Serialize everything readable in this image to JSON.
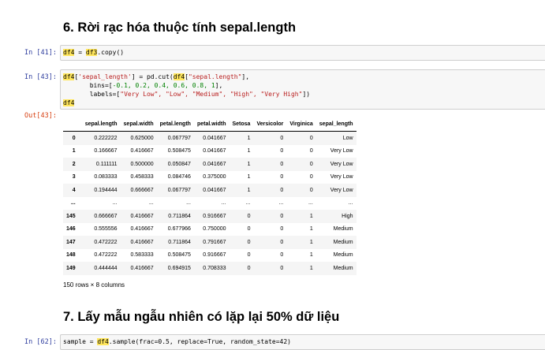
{
  "section6": {
    "heading": "6. Rời rạc hóa thuộc tính sepal.length"
  },
  "cell41": {
    "prompt": "In [41]:",
    "line1": {
      "var": "df4",
      "mid": " = ",
      "src": "df3",
      "end": ".copy()"
    }
  },
  "cell43": {
    "prompt": "In [43]:",
    "line1": {
      "var": "df4",
      "key": "'sepal_length'",
      "mid": "] = pd.cut(",
      "src": "df4",
      "col": "\"sepal.length\"",
      "end": "],",
      "open": "["
    },
    "line2": {
      "pre": "       bins=[",
      "nums": "-0.1, 0.2, 0.4, 0.6, 0.8, 1",
      "end": "],"
    },
    "line3": {
      "pre": "       labels=[",
      "labels": "\"Very Low\", \"Low\", \"Medium\", \"High\", \"Very High\"",
      "end": "])"
    },
    "line4": {
      "var": "df4"
    },
    "out_prompt": "Out[43]:"
  },
  "table": {
    "columns": [
      "",
      "sepal.length",
      "sepal.width",
      "petal.length",
      "petal.width",
      "Setosa",
      "Versicolor",
      "Virginica",
      "sepal_length"
    ],
    "rows": [
      [
        "0",
        "0.222222",
        "0.625000",
        "0.067797",
        "0.041667",
        "1",
        "0",
        "0",
        "Low"
      ],
      [
        "1",
        "0.166667",
        "0.416667",
        "0.508475",
        "0.041667",
        "1",
        "0",
        "0",
        "Very Low"
      ],
      [
        "2",
        "0.111111",
        "0.500000",
        "0.050847",
        "0.041667",
        "1",
        "0",
        "0",
        "Very Low"
      ],
      [
        "3",
        "0.083333",
        "0.458333",
        "0.084746",
        "0.375000",
        "1",
        "0",
        "0",
        "Very Low"
      ],
      [
        "4",
        "0.194444",
        "0.666667",
        "0.067797",
        "0.041667",
        "1",
        "0",
        "0",
        "Very Low"
      ],
      [
        "...",
        "...",
        "...",
        "...",
        "...",
        "...",
        "...",
        "...",
        "..."
      ],
      [
        "145",
        "0.666667",
        "0.416667",
        "0.711864",
        "0.916667",
        "0",
        "0",
        "1",
        "High"
      ],
      [
        "146",
        "0.555556",
        "0.416667",
        "0.677966",
        "0.750000",
        "0",
        "0",
        "1",
        "Medium"
      ],
      [
        "147",
        "0.472222",
        "0.416667",
        "0.711864",
        "0.791667",
        "0",
        "0",
        "1",
        "Medium"
      ],
      [
        "148",
        "0.472222",
        "0.583333",
        "0.508475",
        "0.916667",
        "0",
        "0",
        "1",
        "Medium"
      ],
      [
        "149",
        "0.444444",
        "0.416667",
        "0.694915",
        "0.708333",
        "0",
        "0",
        "1",
        "Medium"
      ]
    ],
    "rows_note": "150 rows × 8 columns"
  },
  "section7": {
    "heading": "7. Lấy mẫu ngẫu nhiên có lặp lại 50% dữ liệu"
  },
  "cell62": {
    "prompt": "In [62]:",
    "line1": {
      "pre": "sample = ",
      "var": "df4",
      "end": ".sample(frac=0.5, replace=True, random_state=42)"
    }
  },
  "colors": {
    "highlight": "#ffe65c",
    "in_prompt": "#303f9f",
    "out_prompt": "#d84315",
    "string": "#ba2121",
    "number": "#008000"
  }
}
